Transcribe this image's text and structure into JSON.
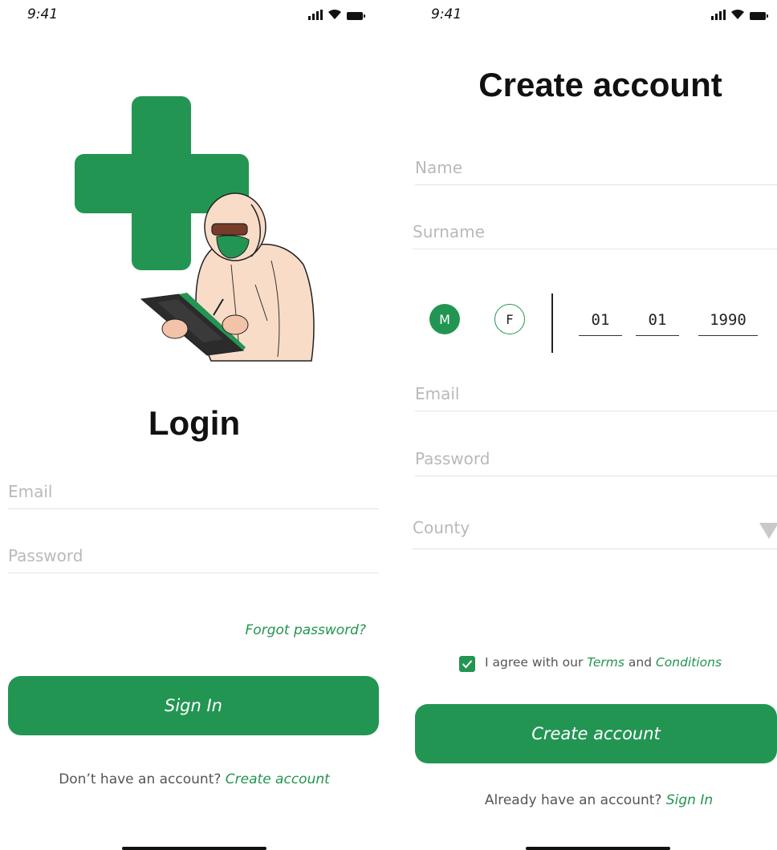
{
  "status": {
    "time_left": "9:41",
    "time_right": "9:41"
  },
  "login": {
    "title": "Login",
    "email_placeholder": "Email",
    "password_placeholder": "Password",
    "forgot_password": "Forgot password?",
    "sign_in": "Sign In",
    "footer_prompt": "Don’t have an account?",
    "footer_link": "Create account"
  },
  "signup": {
    "title": "Create account",
    "name_placeholder": "Name",
    "surname_placeholder": "Surname",
    "gender_male": "M",
    "gender_female": "F",
    "selected_gender": "M",
    "dob_day": "01",
    "dob_month": "01",
    "dob_year": "1990",
    "email_placeholder": "Email",
    "password_placeholder": "Password",
    "county_placeholder": "County",
    "agree_prefix": "I agree with our",
    "agree_terms": "Terms",
    "agree_and": "and",
    "agree_conditions": "Conditions",
    "agree_checked": true,
    "create_button": "Create account",
    "footer_prompt": "Already have an account?",
    "footer_link": "Sign In"
  },
  "colors": {
    "brand_green": "#239553",
    "placeholder_gray": "#b9b9b9",
    "divider": "#e3e3e3"
  }
}
